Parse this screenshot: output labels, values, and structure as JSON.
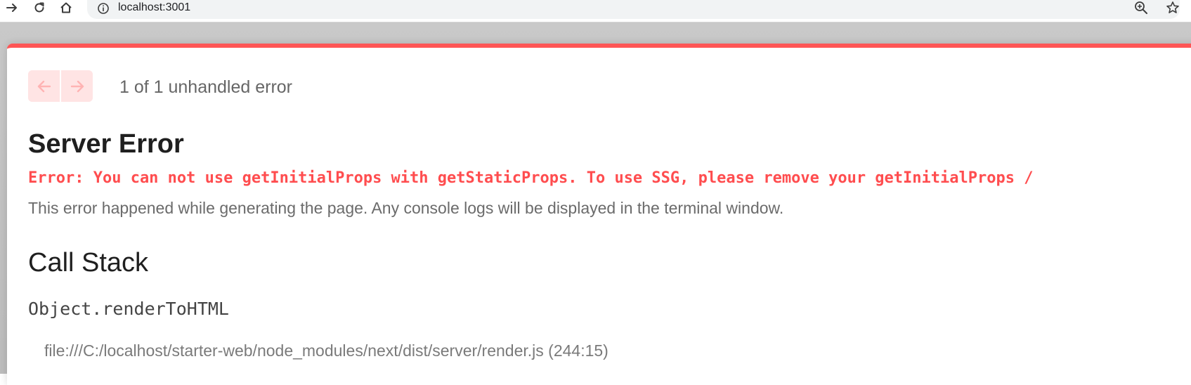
{
  "browser": {
    "url": "localhost:3001",
    "icons": [
      "forward-icon",
      "reload-icon",
      "home-icon",
      "info-icon",
      "zoom-icon",
      "star-icon"
    ]
  },
  "overlay": {
    "accent_color": "#ff5555",
    "pager": {
      "label": "1 of 1 unhandled error"
    },
    "title": "Server Error",
    "error_message": "Error: You can not use getInitialProps with getStaticProps. To use SSG, please remove your getInitialProps /",
    "description": "This error happened while generating the page. Any console logs will be displayed in the terminal window.",
    "call_stack": {
      "heading": "Call Stack",
      "frames": [
        {
          "function": "Object.renderToHTML",
          "location": "file:///C:/localhost/starter-web/node_modules/next/dist/server/render.js (244:15)"
        }
      ]
    }
  }
}
